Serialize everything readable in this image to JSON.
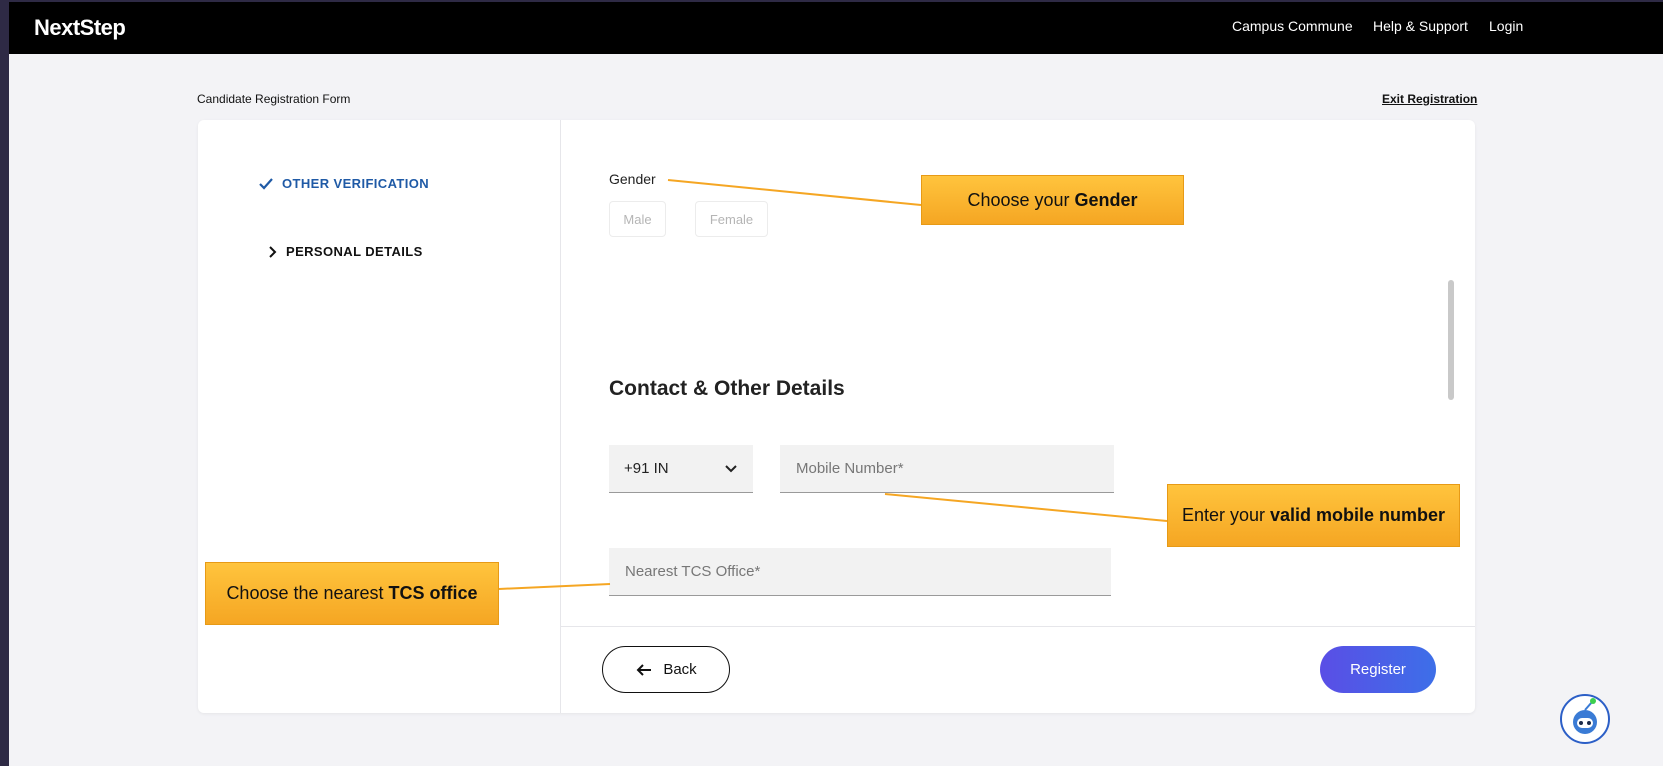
{
  "header": {
    "logo": "NextStep",
    "nav": [
      "Campus Commune",
      "Help & Support",
      "Login"
    ]
  },
  "form": {
    "title": "Candidate Registration Form",
    "exit": "Exit Registration"
  },
  "steps": [
    {
      "label": "OTHER VERIFICATION",
      "status": "done"
    },
    {
      "label": "PERSONAL DETAILS",
      "status": "current"
    }
  ],
  "gender": {
    "label": "Gender",
    "options": [
      "Male",
      "Female"
    ]
  },
  "contact": {
    "title": "Contact & Other Details",
    "country_code": "+91 IN",
    "mobile_placeholder": "Mobile Number*",
    "office_placeholder": "Nearest TCS Office*"
  },
  "buttons": {
    "back": "Back",
    "register": "Register"
  },
  "callouts": {
    "gender": {
      "pre": "Choose your ",
      "bold": "Gender"
    },
    "mobile": {
      "pre": "Enter your ",
      "bold": "valid mobile number"
    },
    "office": {
      "pre": "Choose the nearest ",
      "bold": "TCS office"
    }
  },
  "colors": {
    "accent_blue": "#1f5aa6",
    "callout": "#f5a623",
    "register_gradient_start": "#5a4ee6",
    "register_gradient_end": "#3d6fe8"
  }
}
